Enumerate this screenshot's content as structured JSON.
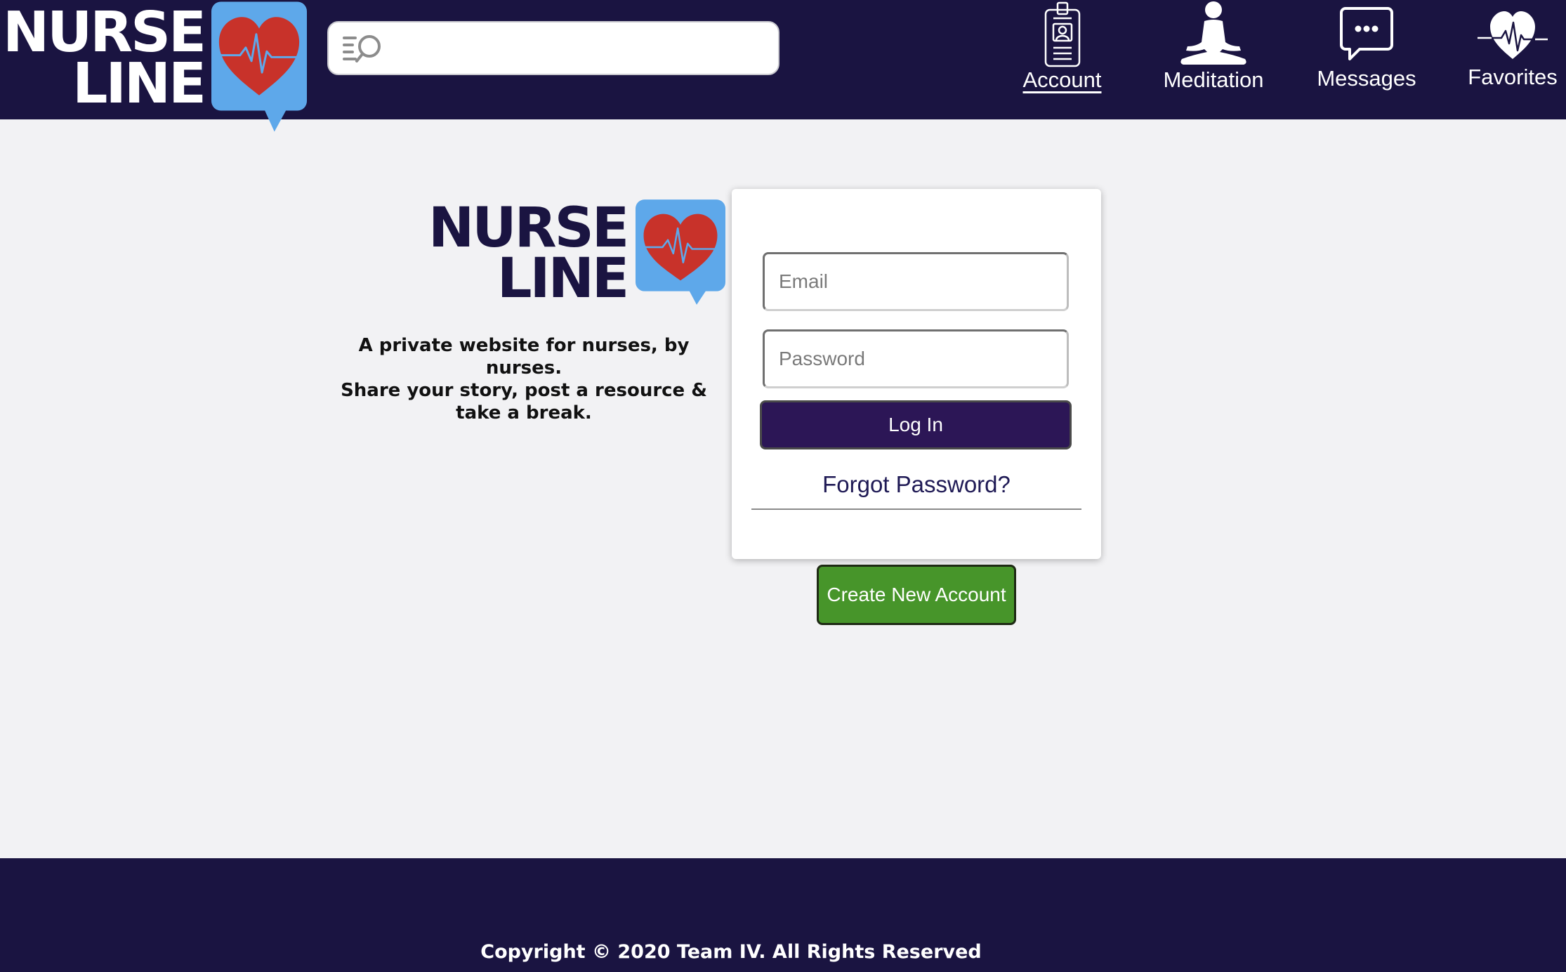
{
  "brand": {
    "logo_line1": "NURSE",
    "logo_line2": "LINE"
  },
  "header": {
    "search": {
      "placeholder": "",
      "value": ""
    },
    "nav": [
      {
        "label": "Account",
        "icon": "id-badge-icon"
      },
      {
        "label": "Meditation",
        "icon": "meditation-icon"
      },
      {
        "label": "Messages",
        "icon": "chat-bubble-icon"
      },
      {
        "label": "Favorites",
        "icon": "heartbeat-icon"
      }
    ]
  },
  "hero": {
    "tagline_line1": "A private website for nurses, by nurses.",
    "tagline_line2": "Share your story, post a resource &",
    "tagline_line3": "take a break."
  },
  "login": {
    "email_placeholder": "Email",
    "password_placeholder": "Password",
    "login_label": "Log In",
    "forgot_label": "Forgot Password?",
    "create_label": "Create New Account"
  },
  "footer": {
    "copyright": "Copyright © 2020 Team IV. All Rights Reserved"
  },
  "colors": {
    "navy": "#1a1441",
    "page_bg": "#f2f2f4",
    "login_button": "#2c1656",
    "create_button": "#47952a",
    "bubble_blue": "#5ea8ea",
    "heart_red": "#c8322a"
  }
}
